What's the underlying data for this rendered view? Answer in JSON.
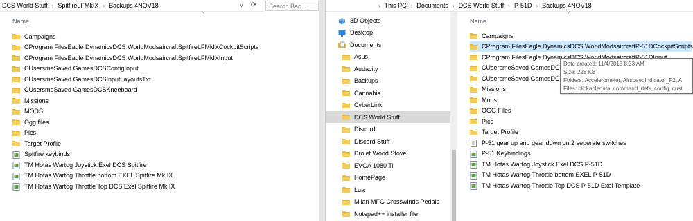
{
  "left": {
    "breadcrumb": [
      "DCS World Stuff",
      "SpitfireLFMkIX",
      "Backups 4NOV18"
    ],
    "search_placeholder": "Search Bac...",
    "column_name": "Name",
    "items": [
      {
        "label": "Campaigns",
        "icon": "folder-icon"
      },
      {
        "label": "CProgram FilesEagle DynamicsDCS WorldModsaircraftSpitfireLFMkIXCockpitScripts",
        "icon": "folder-icon"
      },
      {
        "label": "CProgram FilesEagle DynamicsDCS WorldModsaircraftSpitfireLFMkIXInput",
        "icon": "folder-icon"
      },
      {
        "label": "CUsersmeSaved GamesDCSConfigInput",
        "icon": "folder-icon"
      },
      {
        "label": "CUsersmeSaved GamesDCSInputLayoutsTxt",
        "icon": "folder-icon"
      },
      {
        "label": "CUsersmeSaved GamesDCSKneeboard",
        "icon": "folder-icon"
      },
      {
        "label": "Missions",
        "icon": "folder-icon"
      },
      {
        "label": "MODS",
        "icon": "folder-icon"
      },
      {
        "label": "Ogg files",
        "icon": "folder-icon"
      },
      {
        "label": "Pics",
        "icon": "folder-icon"
      },
      {
        "label": "Target Profile",
        "icon": "folder-icon"
      },
      {
        "label": "Spitfire keybinds",
        "icon": "image-file-icon"
      },
      {
        "label": "TM Hotas Wartog Joystick Exel DCS Spitfire",
        "icon": "image-file-icon"
      },
      {
        "label": "TM Hotas Wartog Throttle bottom EXEL Spitfire Mk IX",
        "icon": "image-file-icon"
      },
      {
        "label": "TM Hotas Wartog Throttle Top DCS Exel Spitfire Mk IX",
        "icon": "image-file-icon"
      }
    ]
  },
  "right": {
    "breadcrumb": [
      "This PC",
      "Documents",
      "DCS World Stuff",
      "P-51D",
      "Backups 4NOV18"
    ],
    "column_name": "Name",
    "nav": [
      {
        "label": "3D Objects",
        "icon": "3d-objects-icon"
      },
      {
        "label": "Desktop",
        "icon": "desktop-icon"
      },
      {
        "label": "Documents",
        "icon": "documents-icon"
      },
      {
        "label": "Asus",
        "icon": "folder-icon"
      },
      {
        "label": "Audacity",
        "icon": "folder-icon"
      },
      {
        "label": "Backups",
        "icon": "folder-icon"
      },
      {
        "label": "Cannabis",
        "icon": "folder-icon"
      },
      {
        "label": "CyberLink",
        "icon": "folder-icon"
      },
      {
        "label": "DCS World Stuff",
        "icon": "folder-icon"
      },
      {
        "label": "Discord",
        "icon": "folder-icon"
      },
      {
        "label": "Discord Stuff",
        "icon": "folder-icon"
      },
      {
        "label": "Drolet Wood Stove",
        "icon": "folder-icon"
      },
      {
        "label": "EVGA 1080 Ti",
        "icon": "folder-icon"
      },
      {
        "label": "HomePage",
        "icon": "folder-icon"
      },
      {
        "label": "Lua",
        "icon": "folder-icon"
      },
      {
        "label": "Milan MFG Crosswinds Pedals",
        "icon": "folder-icon"
      },
      {
        "label": "Notepad++ installer file",
        "icon": "folder-icon"
      }
    ],
    "items": [
      {
        "label": "Campaigns",
        "icon": "folder-icon"
      },
      {
        "label": "CProgram FilesEagle DynamicsDCS WorldModsaircraftP-51DCockpitScripts",
        "icon": "folder-icon"
      },
      {
        "label": "CProgram FilesEagle DynamicsDCS WorldModsaircraftP-51DInput",
        "icon": "folder-icon"
      },
      {
        "label": "CUsersmeSaved GamesDCSConfigInput",
        "icon": "folder-icon"
      },
      {
        "label": "CUsersmeSaved GamesDCSKneeboard",
        "icon": "folder-icon"
      },
      {
        "label": "Missions",
        "icon": "folder-icon"
      },
      {
        "label": "Mods",
        "icon": "folder-icon"
      },
      {
        "label": "OGG Files",
        "icon": "folder-icon"
      },
      {
        "label": "Pics",
        "icon": "folder-icon"
      },
      {
        "label": "Target Profile",
        "icon": "folder-icon"
      },
      {
        "label": "P-51 gear up and gear down on 2 seperate switches",
        "icon": "text-file-icon"
      },
      {
        "label": "P-51 Keybindings",
        "icon": "image-file-icon"
      },
      {
        "label": "TM Hotas Wartog Joystick Exel DCS P-51D",
        "icon": "image-file-icon"
      },
      {
        "label": "TM Hotas Wartog Throttle bottom EXEL P-51D",
        "icon": "image-file-icon"
      },
      {
        "label": "TM Hotas Wartog Throttle Top DCS P-51D Exel Template",
        "icon": "image-file-icon"
      }
    ],
    "tooltip": {
      "date": "Date created: 11/4/2018 8:33 AM",
      "size": "Size: 228 KB",
      "folders": "Folders: Accelerometer, AirspeedIndicator_F2, A",
      "files": "Files: clickabledata, command_defs, config, cust"
    }
  },
  "colors": {
    "folder": "#e8b73a",
    "selection": "#cce8ff",
    "nav_selection": "#d9d9d9",
    "header_text": "#4c607a"
  }
}
